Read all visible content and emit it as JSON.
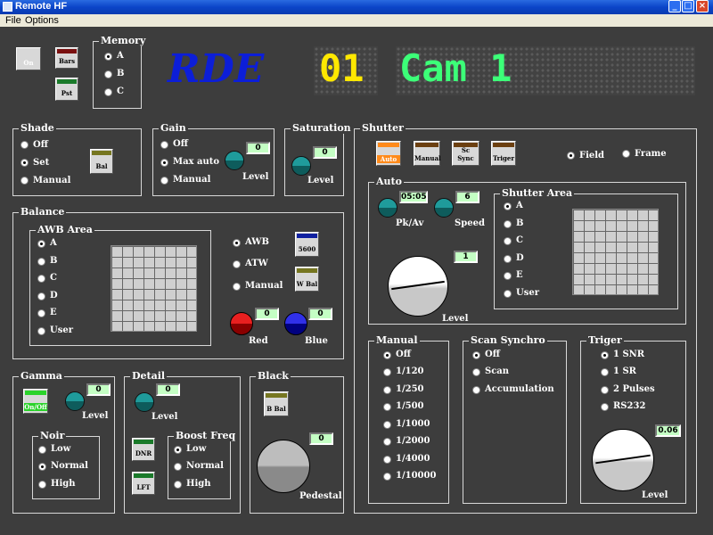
{
  "window": {
    "title": "Remote HF",
    "min": "_",
    "max": "□",
    "close": "×"
  },
  "menu": [
    "File",
    "Options"
  ],
  "top": {
    "on_btn": "On",
    "bars_btn": "Bars",
    "pst_btn": "Pst",
    "memory": {
      "title": "Memory",
      "options": [
        "A",
        "B",
        "C"
      ],
      "selected": "A"
    },
    "logo": "RDE",
    "display_cam_num": "01",
    "display_cam_text": "Cam 1"
  },
  "shade": {
    "title": "Shade",
    "options": [
      "Off",
      "Set",
      "Manual"
    ],
    "selected": "Set",
    "button": "Bal"
  },
  "gain": {
    "title": "Gain",
    "options": [
      "Off",
      "Max auto",
      "Manual"
    ],
    "selected": "Max auto",
    "value": "0",
    "level_label": "Level"
  },
  "saturation": {
    "title": "Saturation",
    "value": "0",
    "level_label": "Level"
  },
  "balance": {
    "title": "Balance",
    "awb_area": {
      "title": "AWB Area",
      "options": [
        "A",
        "B",
        "C",
        "D",
        "E",
        "User"
      ],
      "selected": "A"
    },
    "mode_options": [
      "AWB",
      "ATW",
      "Manual"
    ],
    "mode_selected": "AWB",
    "k5600_btn": "5600",
    "wbal_btn": "W Bal",
    "red_value": "0",
    "blue_value": "0",
    "red_label": "Red",
    "blue_label": "Blue"
  },
  "gamma": {
    "title": "Gamma",
    "onoff_btn": "On/Off",
    "value": "0",
    "level_label": "Level",
    "noir": {
      "title": "Noir",
      "options": [
        "Low",
        "Normal",
        "High"
      ],
      "selected": "Normal"
    }
  },
  "detail": {
    "title": "Detail",
    "value": "0",
    "level_label": "Level",
    "dnr_btn": "DNR",
    "lft_btn": "LFT",
    "boost": {
      "title": "Boost Freq",
      "options": [
        "Low",
        "Normal",
        "High"
      ],
      "selected": "Low"
    }
  },
  "black": {
    "title": "Black",
    "bbal_btn": "B Bal",
    "value": "0",
    "label": "Pedestal"
  },
  "shutter": {
    "title": "Shutter",
    "buttons": [
      "Auto",
      "Manual",
      "Sc Sync",
      "Triger"
    ],
    "mode_options": [
      "Field",
      "Frame"
    ],
    "mode_selected": "Field",
    "auto": {
      "title": "Auto",
      "pkav_value": "05:05",
      "speed_value": "6",
      "pkav_label": "Pk/Av",
      "speed_label": "Speed",
      "level_value": "1",
      "level_label": "Level"
    },
    "area": {
      "title": "Shutter Area",
      "options": [
        "A",
        "B",
        "C",
        "D",
        "E",
        "User"
      ],
      "selected": "A"
    },
    "manual": {
      "title": "Manual",
      "options": [
        "Off",
        "1/120",
        "1/250",
        "1/500",
        "1/1000",
        "1/2000",
        "1/4000",
        "1/10000"
      ],
      "selected": "Off"
    },
    "scan": {
      "title": "Scan Synchro",
      "options": [
        "Off",
        "Scan",
        "Accumulation"
      ],
      "selected": "Off"
    },
    "triger": {
      "title": "Triger",
      "options": [
        "1 SNR",
        "1 SR",
        "2 Pulses",
        "RS232"
      ],
      "selected": "1 SNR",
      "value": "0.06",
      "level_label": "Level"
    }
  },
  "colors": {
    "titlebar": "#0b45c8",
    "panel": "#3d3d3d",
    "value_bg": "#c4ffc4",
    "display_yellow": "#ffe800",
    "display_green": "#3cff78",
    "logo_blue": "#0c1ed8"
  }
}
